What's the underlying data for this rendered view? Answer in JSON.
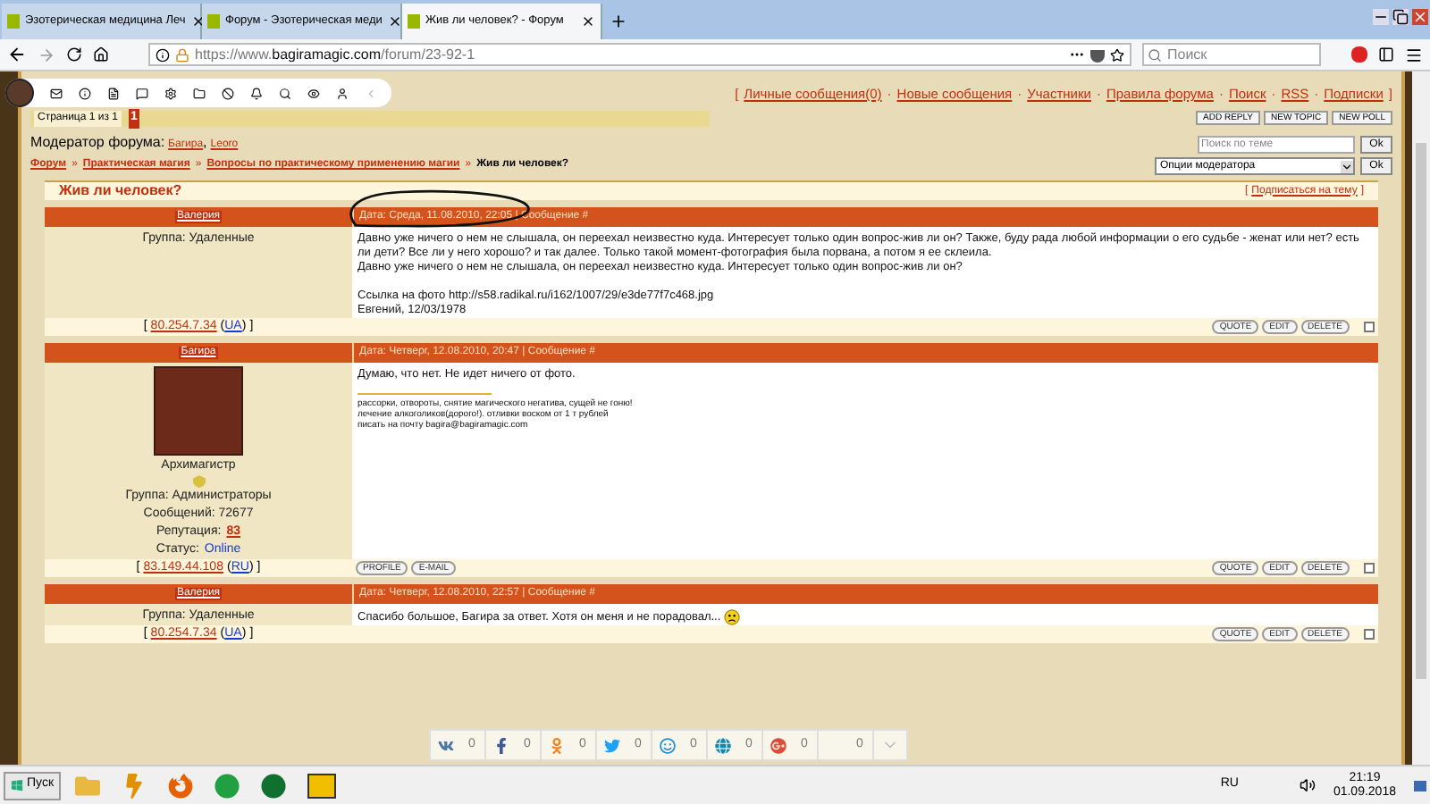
{
  "browser": {
    "tabs": [
      {
        "title": "Эзотерическая медицина Леч",
        "selected": false
      },
      {
        "title": "Форум - Эзотерическая меди",
        "selected": false
      },
      {
        "title": "Жив ли человек? - Форум",
        "selected": true
      }
    ],
    "url_prefix": "https://www.",
    "url_domain": "bagiramagic.com",
    "url_path": "/forum/23-92-1",
    "search_placeholder": "Поиск"
  },
  "forum": {
    "top_links": {
      "open": "[",
      "close": "]",
      "separator": "·",
      "items": [
        "Личные сообщения(0)",
        "Новые сообщения",
        "Участники",
        "Правила форума",
        "Поиск",
        "RSS",
        "Подписки"
      ]
    },
    "pagination": {
      "label": "Страница 1 из 1",
      "pages": [
        {
          "label": "1",
          "selected": true
        }
      ]
    },
    "action_buttons": [
      "ADD REPLY",
      "NEW TOPIC",
      "NEW POLL"
    ],
    "moderators": {
      "label": "Модератор форума:",
      "names": [
        "Багира",
        "Leoro"
      ],
      "separator": ","
    },
    "breadcrumb": [
      {
        "kind": "link",
        "text": "Форум"
      },
      {
        "kind": "sep",
        "text": "»"
      },
      {
        "kind": "link",
        "text": "Практическая магия"
      },
      {
        "kind": "sep",
        "text": "»"
      },
      {
        "kind": "link",
        "text": "Вопросы по практическому применению магии"
      },
      {
        "kind": "sep",
        "text": "»"
      },
      {
        "kind": "current",
        "text": "Жив ли человек?"
      }
    ],
    "topic_search": {
      "placeholder": "Поиск по теме",
      "button": "Ok"
    },
    "moderator_options": {
      "value": "Опции модератора",
      "button": "Ok"
    },
    "thread_title": "Жив ли человек?",
    "subscribe": {
      "open": "[",
      "link": "Подписаться на тему",
      "close": "]"
    },
    "posts": [
      {
        "author": "Валерия",
        "date": "Дата: Среда, 11.08.2010, 22:05 | Сообщение #",
        "group": "Группа: Удаленные",
        "body": [
          "Давно уже ничего о нем не слышала, он переехал неизвестно куда. Интересует только один вопрос-жив ли он? Также, буду рада любой информации о его судьбе - женат или нет? есть ли дети? Все ли у него хорошо? и так далее. Только такой момент-фотография была порвана, а потом я ее склеила.",
          "Давно уже ничего о нем не слышала, он переехал неизвестно куда. Интересует только один вопрос-жив ли он?"
        ],
        "extra": [
          "Ссылка на фото http://s58.radikal.ru/i162/1007/29/e3de77f7c468.jpg",
          "Евгений, 12/03/1978"
        ],
        "footer": {
          "open": "[",
          "ip": "80.254.7.34",
          "country_open": "(",
          "country": "UA",
          "country_close": ")",
          "close": "]"
        },
        "right_buttons": [
          "QUOTE",
          "EDIT",
          "DELETE"
        ],
        "selected": false
      },
      {
        "author": "Багира",
        "date": "Дата: Четверг, 12.08.2010, 20:47 | Сообщение #",
        "avatar": true,
        "rank": "Архимагистр",
        "group": "Группа: Администраторы",
        "post_count": "Сообщений: 72677",
        "reputation_label": "Репутация:",
        "reputation": "83",
        "status_label": "Статус:",
        "status": "Online",
        "body": [
          "Думаю, что нет. Не идет ничего от фото."
        ],
        "signature": [
          "рассорки, отвороты, снятие магического негатива, сущей не гоню!",
          "лечение алкоголиков(дорого!). отливки воском от 1 т рублей",
          "писать на почту bagira@bagiramagic.com"
        ],
        "footer": {
          "open": "[",
          "ip": "83.149.44.108",
          "country_open": "(",
          "country": "RU",
          "country_close": ")",
          "close": "]"
        },
        "left_buttons": [
          "PROFILE",
          "E-MAIL"
        ],
        "right_buttons": [
          "QUOTE",
          "EDIT",
          "DELETE"
        ],
        "selected": false
      },
      {
        "author": "Валерия",
        "date": "Дата: Четверг, 12.08.2010, 22:57 | Сообщение #",
        "group": "Группа: Удаленные",
        "body": [
          "Спасибо большое, Багира за ответ. Хотя он меня и не порадовал..."
        ],
        "smiley": true,
        "footer": {
          "open": "[",
          "ip": "80.254.7.34",
          "country_open": "(",
          "country": "UA",
          "country_close": ")",
          "close": "]"
        },
        "right_buttons": [
          "QUOTE",
          "EDIT",
          "DELETE"
        ],
        "selected": false
      }
    ]
  },
  "share_bar": [
    {
      "kind": "vk",
      "count": "0",
      "color": "#4a76a8"
    },
    {
      "kind": "facebook",
      "count": "0",
      "color": "#3b5998"
    },
    {
      "kind": "ok",
      "count": "0",
      "color": "#f58220"
    },
    {
      "kind": "twitter",
      "count": "0",
      "color": "#1da1f2"
    },
    {
      "kind": "mail",
      "count": "0",
      "color": "#168de2"
    },
    {
      "kind": "globe",
      "count": "0",
      "color": "#0d8ab8"
    },
    {
      "kind": "gplus",
      "count": "0",
      "color": "#dd4b39"
    },
    {
      "kind": "blank",
      "count": "0"
    }
  ],
  "taskbar": {
    "start": "Пуск",
    "language": "RU",
    "time": "21:19",
    "date": "01.09.2018"
  }
}
